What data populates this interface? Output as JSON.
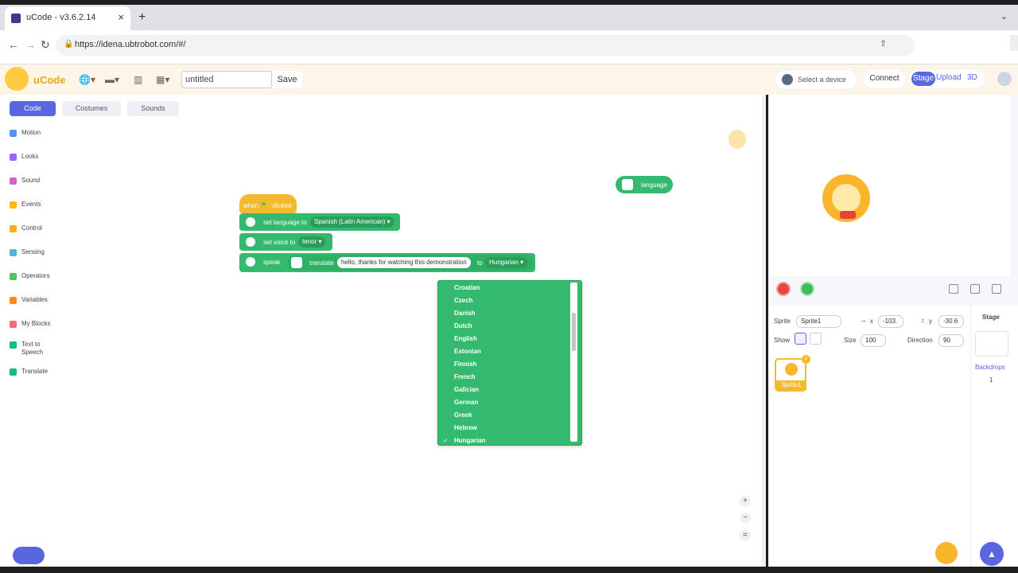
{
  "browser": {
    "tab_title": "uCode - v3.6.2.14",
    "tab_close": "×",
    "new_tab": "+",
    "tab_menu": "⌄",
    "url": "https://idena.ubtrobot.com/#/",
    "back": "←",
    "forward": "→",
    "reload": "↻"
  },
  "header": {
    "app_name": "uCode",
    "project_name": "untitled",
    "save_label": "Save",
    "device_label": "Select a device",
    "connect_label": "Connect",
    "mode_stage": "Stage",
    "mode_upload": "Upload",
    "mode_3d": "3D"
  },
  "editor_tabs": {
    "code": "Code",
    "costumes": "Costumes",
    "sounds": "Sounds"
  },
  "categories": [
    {
      "label": "Motion",
      "color": "#4c97ff"
    },
    {
      "label": "Looks",
      "color": "#9966ff"
    },
    {
      "label": "Sound",
      "color": "#cf63cf"
    },
    {
      "label": "Events",
      "color": "#ffbf00"
    },
    {
      "label": "Control",
      "color": "#ffab19"
    },
    {
      "label": "Sensing",
      "color": "#5cb1d6"
    },
    {
      "label": "Operators",
      "color": "#59c059"
    },
    {
      "label": "Variables",
      "color": "#ff8c1a"
    },
    {
      "label": "My Blocks",
      "color": "#ff6680"
    },
    {
      "label": "Text to Speech",
      "color": "#0fbd8c"
    },
    {
      "label": "Translate",
      "color": "#0fbd8c"
    }
  ],
  "script": {
    "hat_when": "when",
    "hat_clicked": "clicked",
    "set_language_label": "set language to",
    "set_language_value": "Spanish (Latin American) ▾",
    "set_voice_label": "set voice to",
    "set_voice_value": "tenor ▾",
    "speak_label": "speak",
    "translate_label": "translate",
    "translate_text": "hello, thanks for watching this demonstration",
    "to_label": "to",
    "target_language": "Hungarian ▾",
    "reporter_language": "language"
  },
  "dropdown": {
    "items": [
      "Croatian",
      "Czech",
      "Danish",
      "Dutch",
      "English",
      "Estonian",
      "Finnish",
      "French",
      "Galician",
      "German",
      "Greek",
      "Hebrew",
      "Hungarian"
    ],
    "checked": "Hungarian",
    "check_mark": "✓"
  },
  "zoom": {
    "in": "+",
    "out": "−",
    "reset": "="
  },
  "sprite_info": {
    "sprite_label": "Sprite",
    "sprite_name": "Sprite1",
    "x_label": "x",
    "x_value": "-103.",
    "y_label": "y",
    "y_value": "-30.6",
    "show_label": "Show",
    "size_label": "Size",
    "size_value": "100",
    "direction_label": "Direction",
    "direction_value": "90",
    "thumb_name": "Sprite1"
  },
  "stage_panel": {
    "title": "Stage",
    "backdrops_label": "Backdrops",
    "backdrops_count": "1"
  },
  "colors": {
    "accent": "#5a66e0",
    "block_green": "#33ba6e",
    "event_yellow": "#f5b92e"
  }
}
